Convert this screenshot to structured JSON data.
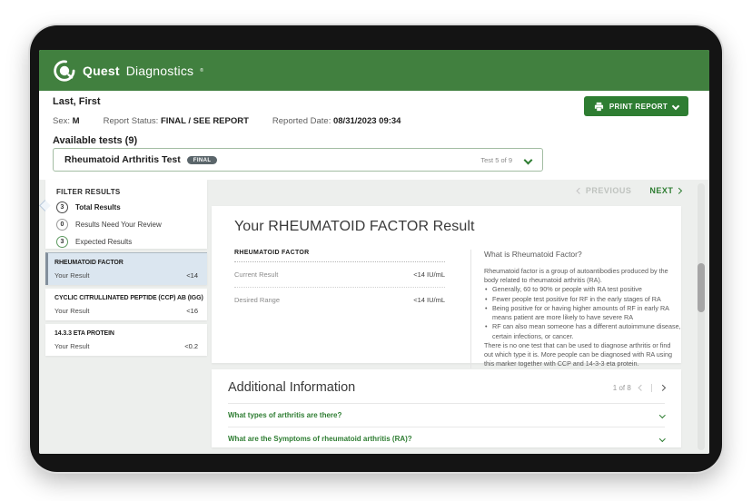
{
  "brand": {
    "logo_bold": "Quest",
    "logo_light": "Diagnostics",
    "trademark": "®",
    "header_bg": "#41803f",
    "accent_green": "#2e7d32"
  },
  "patient": {
    "name": "Last, First",
    "sex_label": "Sex:",
    "sex_value": "M",
    "report_status_label": "Report Status:",
    "report_status_value": "FINAL / SEE REPORT",
    "reported_date_label": "Reported Date:",
    "reported_date_value": "08/31/2023 09:34"
  },
  "toolbar": {
    "print_label": "PRINT REPORT"
  },
  "tests": {
    "available_label": "Available tests (9)",
    "selected_test": "Rheumatoid Arthritis Test",
    "selected_badge": "FINAL",
    "position": "Test 5 of 9"
  },
  "filter": {
    "title": "FILTER RESULTS",
    "items": [
      {
        "count": "3",
        "label": "Total Results"
      },
      {
        "count": "0",
        "label": "Results Need Your Review"
      },
      {
        "count": "3",
        "label": "Expected Results"
      }
    ]
  },
  "result_list": [
    {
      "name": "RHEUMATOID FACTOR",
      "label": "Your Result",
      "value": "<14"
    },
    {
      "name": "CYCLIC CITRULLINATED PEPTIDE (CCP) AB (IGG)",
      "label": "Your Result",
      "value": "<16"
    },
    {
      "name": "14.3.3 ETA PROTEIN",
      "label": "Your Result",
      "value": "<0.2"
    }
  ],
  "nav": {
    "previous": "PREVIOUS",
    "next": "NEXT"
  },
  "result_detail": {
    "title": "Your RHEUMATOID FACTOR Result",
    "table_header": "RHEUMATOID FACTOR",
    "rows": [
      {
        "label": "Current Result",
        "value": "<14 IU/mL"
      },
      {
        "label": "Desired Range",
        "value": "<14 IU/mL"
      }
    ],
    "info_title": "What is Rheumatoid Factor?",
    "info_intro": "Rheumatoid factor is a group of autoantibodies produced by the body related to rheumatoid arthritis (RA).",
    "info_bullets": [
      "Generally, 60 to 90% or people with RA test positive",
      "Fewer people test positive for RF in the early stages of RA",
      "Being positive for or having higher amounts of RF in early RA means patient are more likely to have severe RA",
      "RF can also mean someone has a different autoimmune disease, certain infections, or cancer."
    ],
    "info_footer": "There is no one test that can be used to diagnose arthritis or find out which type it is. More people can be diagnosed with RA using this marker together with CCP and 14-3-3 eta protein."
  },
  "additional": {
    "title": "Additional Information",
    "pagination": "1 of 8",
    "questions": [
      "What types of arthritis are there?",
      "What are the Symptoms of rheumatoid arthritis (RA)?"
    ]
  },
  "icons": {
    "logo": "quest-q-swirl",
    "print": "printer-icon",
    "chevrons": "css-chevron-shapes"
  }
}
